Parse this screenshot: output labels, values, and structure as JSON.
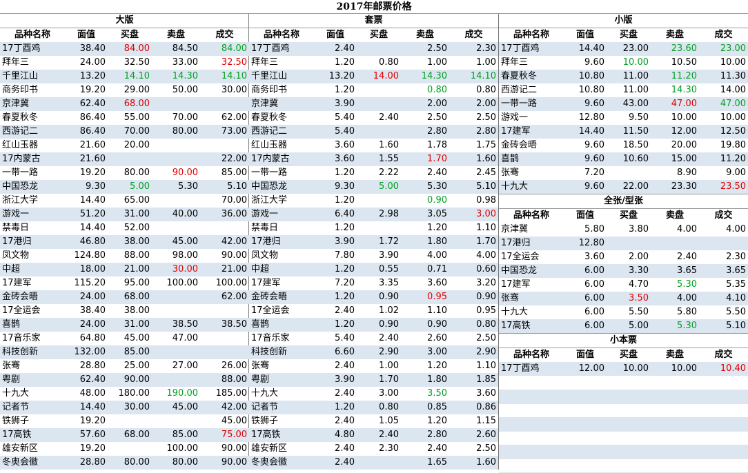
{
  "title": "2017年邮票价格",
  "headers": [
    "品种名称",
    "面值",
    "买盘",
    "卖盘",
    "成交"
  ],
  "colors": {
    "red": "#e00000",
    "green": "#00a020",
    "stripe": "#dce6f1"
  },
  "sections": {
    "big": {
      "title": "大版",
      "rows": [
        [
          "17丁酉鸡",
          "38.40",
          "84.00|r",
          "84.50",
          "84.00|g"
        ],
        [
          "拜年三",
          "24.00",
          "32.50",
          "33.00",
          "32.50|r"
        ],
        [
          "千里江山",
          "13.20",
          "14.10|g",
          "14.30|g",
          "14.10|g"
        ],
        [
          "商务印书",
          "19.20",
          "29.00",
          "50.00",
          "30.00"
        ],
        [
          "京津冀",
          "62.40",
          "68.00|r",
          "",
          ""
        ],
        [
          "春夏秋冬",
          "86.40",
          "55.00",
          "70.00",
          "62.00"
        ],
        [
          "西游记二",
          "86.40",
          "70.00",
          "80.00",
          "73.00"
        ],
        [
          "红山玉器",
          "21.60",
          "20.00",
          "",
          ""
        ],
        [
          "17内蒙古",
          "21.60",
          "",
          "",
          "22.00"
        ],
        [
          "一带一路",
          "19.20",
          "80.00",
          "90.00|r",
          "85.00"
        ],
        [
          "中国恐龙",
          "9.30",
          "5.00|g",
          "5.30",
          "5.10"
        ],
        [
          "浙江大学",
          "14.40",
          "65.00",
          "",
          "70.00"
        ],
        [
          "游戏一",
          "51.20",
          "31.00",
          "40.00",
          "36.00"
        ],
        [
          "禁毒日",
          "14.40",
          "52.00",
          "",
          ""
        ],
        [
          "17港归",
          "46.80",
          "38.00",
          "45.00",
          "42.00"
        ],
        [
          "凤文物",
          "124.80",
          "88.00",
          "98.00",
          "90.00"
        ],
        [
          "中超",
          "18.00",
          "21.00",
          "30.00|r",
          "21.00"
        ],
        [
          "17建军",
          "115.20",
          "95.00",
          "100.00",
          "100.00"
        ],
        [
          "金砖会晤",
          "24.00",
          "68.00",
          "",
          "62.00"
        ],
        [
          "17全运会",
          "38.40",
          "38.00",
          "",
          ""
        ],
        [
          "喜鹊",
          "24.00",
          "31.00",
          "38.50",
          "38.50"
        ],
        [
          "17音乐家",
          "64.80",
          "45.00",
          "47.00",
          ""
        ],
        [
          "科技创新",
          "132.00",
          "85.00",
          "",
          ""
        ],
        [
          "张骞",
          "28.80",
          "25.00",
          "27.00",
          "26.00"
        ],
        [
          "粤剧",
          "62.40",
          "90.00",
          "",
          "88.00"
        ],
        [
          "十九大",
          "48.00",
          "180.00",
          "190.00|g",
          "185.00"
        ],
        [
          "记者节",
          "14.40",
          "30.00",
          "45.00",
          "42.00"
        ],
        [
          "铁狮子",
          "19.20",
          "",
          "",
          "45.00"
        ],
        [
          "17高铁",
          "57.60",
          "68.00",
          "85.00",
          "75.00|r"
        ],
        [
          "雄安新区",
          "19.20",
          "",
          "100.00",
          "90.00"
        ],
        [
          "冬奥会徽",
          "28.80",
          "80.00",
          "80.00",
          "90.00"
        ]
      ]
    },
    "set": {
      "title": "套票",
      "rows": [
        [
          "17丁酉鸡",
          "2.40",
          "",
          "2.50",
          "2.30"
        ],
        [
          "拜年三",
          "1.20",
          "0.80",
          "1.00",
          "1.00"
        ],
        [
          "千里江山",
          "13.20",
          "14.00|r",
          "14.30|g",
          "14.10|g"
        ],
        [
          "商务印书",
          "1.20",
          "",
          "0.80|g",
          "0.80"
        ],
        [
          "京津冀",
          "3.90",
          "",
          "2.00",
          "2.00"
        ],
        [
          "春夏秋冬",
          "5.40",
          "2.40",
          "2.50",
          "2.50"
        ],
        [
          "西游记二",
          "5.40",
          "",
          "2.80",
          "2.80"
        ],
        [
          "红山玉器",
          "3.60",
          "1.60",
          "1.78",
          "1.75"
        ],
        [
          "17内蒙古",
          "3.60",
          "1.55",
          "1.70|r",
          "1.60"
        ],
        [
          "一带一路",
          "1.20",
          "2.22",
          "2.40",
          "2.45"
        ],
        [
          "中国恐龙",
          "9.30",
          "5.00|g",
          "5.30",
          "5.10"
        ],
        [
          "浙江大学",
          "1.20",
          "",
          "0.90|g",
          "0.98"
        ],
        [
          "游戏一",
          "6.40",
          "2.98",
          "3.05",
          "3.00|r"
        ],
        [
          "禁毒日",
          "1.20",
          "",
          "1.20",
          "1.10"
        ],
        [
          "17港归",
          "3.90",
          "1.72",
          "1.80",
          "1.70"
        ],
        [
          "凤文物",
          "7.80",
          "3.90",
          "4.00",
          "4.00"
        ],
        [
          "中超",
          "1.20",
          "0.55",
          "0.71",
          "0.60"
        ],
        [
          "17建军",
          "7.20",
          "3.35",
          "3.60",
          "3.20"
        ],
        [
          "金砖会晤",
          "1.20",
          "0.90",
          "0.95|r",
          "0.90"
        ],
        [
          "17全运会",
          "2.40",
          "1.02",
          "1.10",
          "0.95"
        ],
        [
          "喜鹊",
          "1.20",
          "0.90",
          "0.90",
          "0.80"
        ],
        [
          "17音乐家",
          "5.40",
          "2.40",
          "2.60",
          "2.50"
        ],
        [
          "科技创新",
          "6.60",
          "2.90",
          "3.00",
          "2.90"
        ],
        [
          "张骞",
          "2.40",
          "1.00",
          "1.20",
          "1.10"
        ],
        [
          "粤剧",
          "3.90",
          "1.70",
          "1.80",
          "1.85"
        ],
        [
          "十九大",
          "2.40",
          "3.00",
          "3.50|g",
          "3.60"
        ],
        [
          "记者节",
          "1.20",
          "0.80",
          "0.85",
          "0.86"
        ],
        [
          "铁狮子",
          "2.40",
          "1.05",
          "1.20",
          "1.15"
        ],
        [
          "17高铁",
          "4.80",
          "2.40",
          "2.80",
          "2.60"
        ],
        [
          "雄安新区",
          "2.40",
          "2.30",
          "2.40",
          "2.50"
        ],
        [
          "冬奥会徽",
          "2.40",
          "",
          "1.65",
          "1.60"
        ]
      ]
    },
    "small": {
      "title": "小版",
      "rows": [
        [
          "17丁酉鸡",
          "14.40",
          "23.00",
          "23.60|g",
          "23.00|g"
        ],
        [
          "拜年三",
          "9.60",
          "10.00|g",
          "10.50",
          "10.00"
        ],
        [
          "春夏秋冬",
          "10.80",
          "11.00",
          "11.20|g",
          "11.30"
        ],
        [
          "西游记二",
          "10.80",
          "11.00",
          "14.30|g",
          "14.00"
        ],
        [
          "一带一路",
          "9.60",
          "43.00",
          "47.00|r",
          "47.00|g"
        ],
        [
          "游戏一",
          "12.80",
          "9.50",
          "10.00",
          "10.00"
        ],
        [
          "17建军",
          "14.40",
          "11.50",
          "12.00",
          "12.50"
        ],
        [
          "金砖会晤",
          "9.60",
          "18.50",
          "20.00",
          "19.80"
        ],
        [
          "喜鹊",
          "9.60",
          "10.60",
          "15.00",
          "11.20"
        ],
        [
          "张骞",
          "7.20",
          "",
          "8.90",
          "9.00"
        ],
        [
          "十九大",
          "9.60",
          "22.00",
          "23.30",
          "23.50|r"
        ]
      ]
    },
    "sheet": {
      "title": "全张/型张",
      "rows": [
        [
          "京津冀",
          "5.80",
          "3.80",
          "4.00",
          "4.00"
        ],
        [
          "17港归",
          "12.80",
          "",
          "",
          ""
        ],
        [
          "17全运会",
          "3.60",
          "2.00",
          "2.40",
          "2.30"
        ],
        [
          "中国恐龙",
          "6.00",
          "3.30",
          "3.65",
          "3.65"
        ],
        [
          "17建军",
          "6.00",
          "4.70",
          "5.30|g",
          "5.35"
        ],
        [
          "张骞",
          "6.00",
          "3.50|r",
          "4.00",
          "4.10"
        ],
        [
          "十九大",
          "6.00",
          "5.50",
          "5.80",
          "5.50"
        ],
        [
          "17高铁",
          "6.00",
          "5.00",
          "5.30|g",
          "5.10"
        ]
      ]
    },
    "booklet": {
      "title": "小本票",
      "rows": [
        [
          "17丁酉鸡",
          "12.00",
          "10.00",
          "10.00",
          "10.40|r"
        ]
      ]
    }
  }
}
